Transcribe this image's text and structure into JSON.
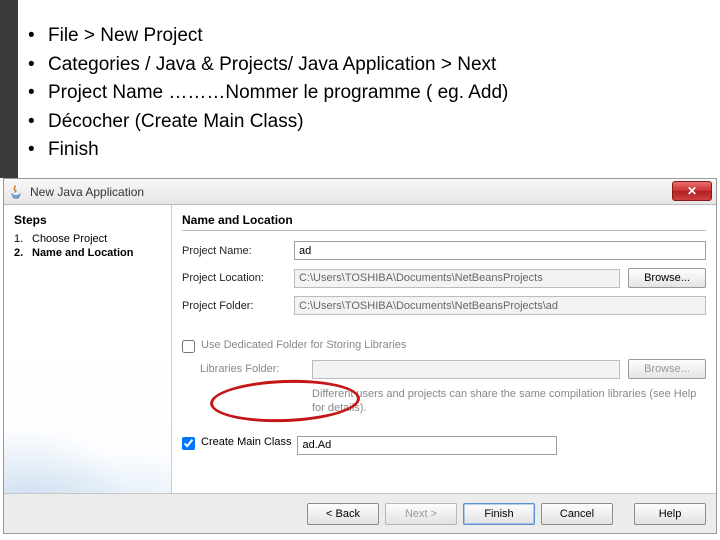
{
  "instructions": {
    "items": [
      {
        "plain": "File > New Project"
      },
      {
        "plain": "Categories / Java     &     Projects/ Java Application     > Next"
      },
      {
        "plain": "Project Name ………Nommer le programme ( eg. Add)"
      },
      {
        "plain": "Décocher (Create Main Class)"
      },
      {
        "plain": "Finish"
      }
    ]
  },
  "wizard": {
    "title": "New Java Application",
    "close_glyph": "✕",
    "steps_header": "Steps",
    "steps": [
      {
        "num": "1.",
        "label": "Choose Project"
      },
      {
        "num": "2.",
        "label": "Name and Location"
      }
    ],
    "section_header": "Name and Location",
    "project_name_label": "Project Name:",
    "project_name_value": "ad",
    "project_location_label": "Project Location:",
    "project_location_value": "C:\\Users\\TOSHIBA\\Documents\\NetBeansProjects",
    "project_folder_label": "Project Folder:",
    "project_folder_value": "C:\\Users\\TOSHIBA\\Documents\\NetBeansProjects\\ad",
    "browse_label": "Browse...",
    "dedicated_folder_label": "Use Dedicated Folder for Storing Libraries",
    "libraries_folder_label": "Libraries Folder:",
    "libraries_folder_value": "",
    "dedicated_hint": "Different users and projects can share the same compilation libraries (see Help for details).",
    "create_main_class_label": "Create Main Class",
    "create_main_class_value": "ad.Ad",
    "buttons": {
      "back": "< Back",
      "next": "Next >",
      "finish": "Finish",
      "cancel": "Cancel",
      "help": "Help"
    }
  }
}
